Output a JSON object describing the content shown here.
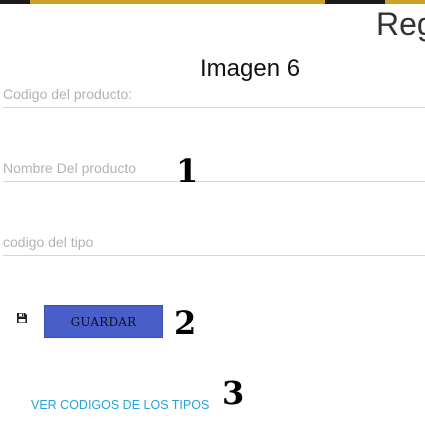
{
  "header": {
    "title": "Reg"
  },
  "caption": "Imagen 6",
  "form": {
    "product_code_placeholder": "Codigo del producto:",
    "product_name_placeholder": "Nombre Del producto",
    "type_code_placeholder": "codigo del tipo",
    "save_icon": "floppy-disk-icon",
    "save_label": "GUARDAR",
    "types_link_label": "VER CODIGOS DE LOS TIPOS"
  },
  "markers": [
    "1",
    "2",
    "3"
  ],
  "colors": {
    "accent_bar": "#c9a227",
    "button_bg": "#4a5ec9",
    "link": "#29a3d6"
  }
}
